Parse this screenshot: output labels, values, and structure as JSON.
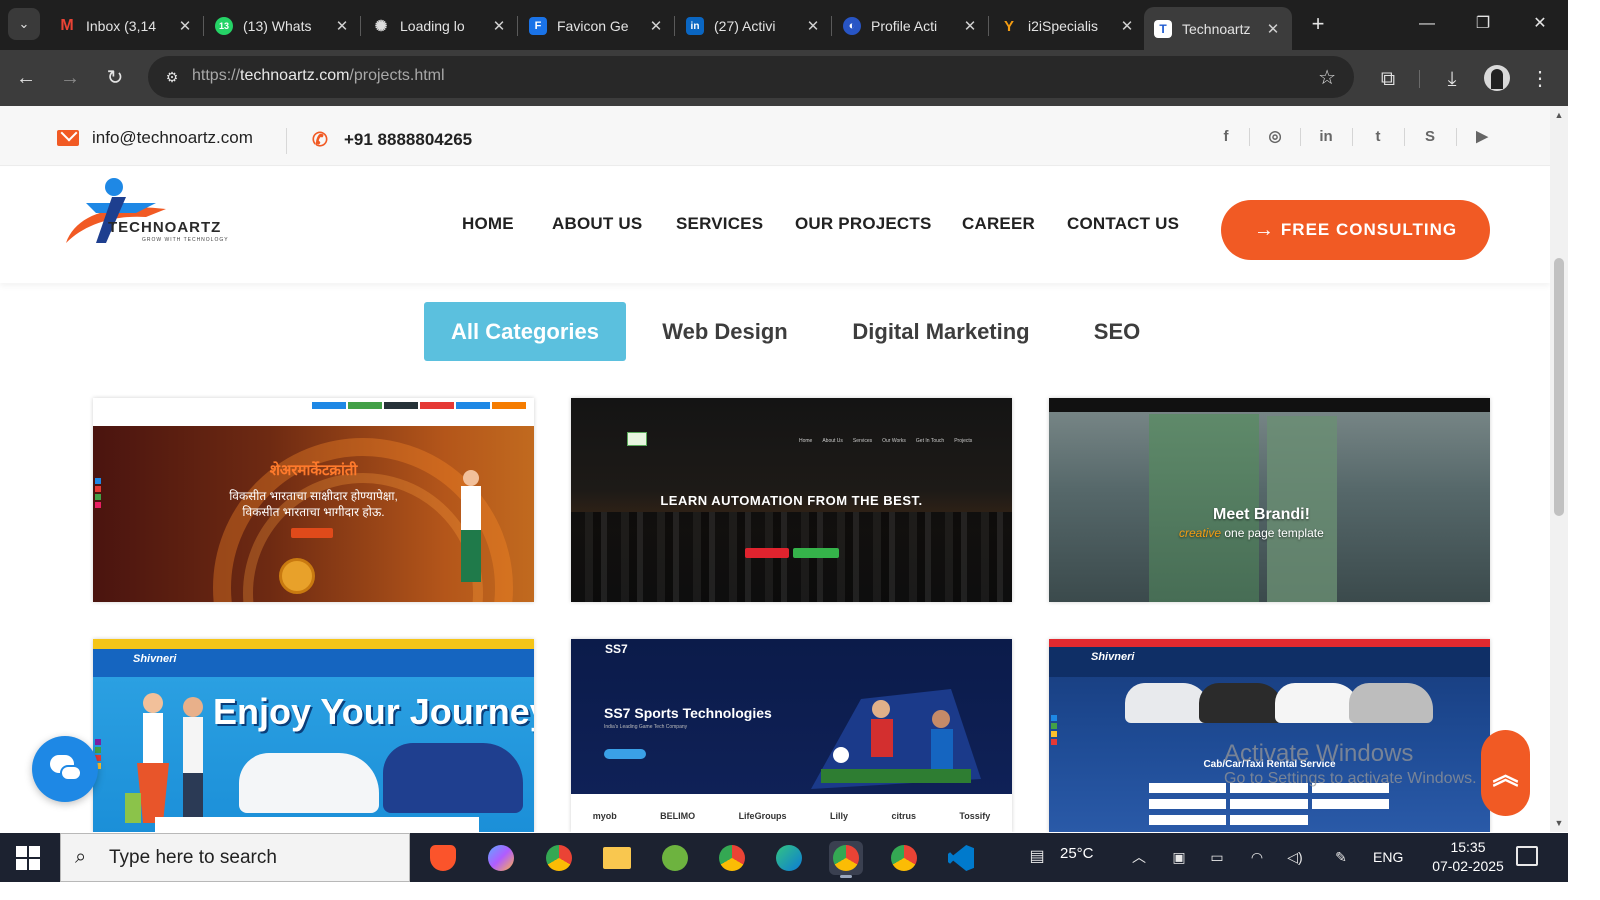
{
  "browser": {
    "tabs": [
      {
        "title": "Inbox (3,14",
        "favicon": "gmail-icon",
        "color": "#ea4335",
        "glyph": "M",
        "active": false
      },
      {
        "title": "(13) Whats",
        "favicon": "whatsapp-icon",
        "color": "#25d366",
        "glyph": "13",
        "active": false
      },
      {
        "title": "Loading lo",
        "favicon": "openai-icon",
        "color": "#2a2a2a",
        "glyph": "✺",
        "active": false
      },
      {
        "title": "Favicon Ge",
        "favicon": "favicon-generator-icon",
        "color": "#1a73e8",
        "glyph": "F",
        "active": false
      },
      {
        "title": "(27) Activi",
        "favicon": "linkedin-icon",
        "color": "#0a66c2",
        "glyph": "in",
        "active": false
      },
      {
        "title": "Profile Acti",
        "favicon": "profile-globe-icon",
        "color": "#2855c5",
        "glyph": "◐",
        "active": false
      },
      {
        "title": "i2iSpecialis",
        "favicon": "i2i-icon",
        "color": "#1f1f1f",
        "glyph": "Y",
        "active": false
      },
      {
        "title": "Technoartz",
        "favicon": "technoartz-icon",
        "color": "#ffffff",
        "glyph": "T",
        "active": true
      }
    ],
    "url_scheme": "https://",
    "url_host": "technoartz.com",
    "url_path": "/projects.html"
  },
  "topbar": {
    "email": "info@technoartz.com",
    "phone": "+91 8888804265",
    "social": [
      "f",
      "◎",
      "in",
      "t",
      "S",
      "▶"
    ]
  },
  "header": {
    "logo_text": "TECHNOARTZ",
    "logo_tagline": "GROW WITH TECHNOLOGY",
    "nav": [
      "HOME",
      "ABOUT US",
      "SERVICES",
      "OUR PROJECTS",
      "CAREER",
      "CONTACT US"
    ],
    "cta": "FREE CONSULTING",
    "accent": "#f15a24"
  },
  "filters": {
    "items": [
      "All Categories",
      "Web Design",
      "Digital Marketing",
      "SEO"
    ],
    "active_color": "#5bc0de"
  },
  "projects": {
    "card1": {
      "title": "शेअरमार्केटक्रांती",
      "sub1": "विकसीत भारताचा साक्षीदार होण्यापेक्षा,",
      "sub2": "विकसीत भारताचा भागीदार होऊ."
    },
    "card2": {
      "title": "LEARN AUTOMATION FROM THE BEST."
    },
    "card3": {
      "title": "Meet Brandi!",
      "sub_accent": "creative",
      "sub": " one page template"
    },
    "card4": {
      "title": "Enjoy Your Journey",
      "brand": "Shivneri"
    },
    "card5": {
      "title": "SS7 Sports Technologies",
      "sub": "India's Leading Game Tech Company",
      "brand": "SS7",
      "logos": [
        "myob",
        "BELIMO",
        "LifeGroups",
        "Lilly",
        "citrus",
        "Tossify"
      ]
    },
    "card6": {
      "title": "Cab/Car/Taxi Rental Service",
      "brand": "Shivneri"
    }
  },
  "watermark": {
    "line1": "Activate Windows",
    "line2": "Go to Settings to activate Windows."
  },
  "taskbar": {
    "search_placeholder": "Type here to search",
    "weather": "25°C",
    "language": "ENG",
    "time": "15:35",
    "date": "07-02-2025"
  }
}
